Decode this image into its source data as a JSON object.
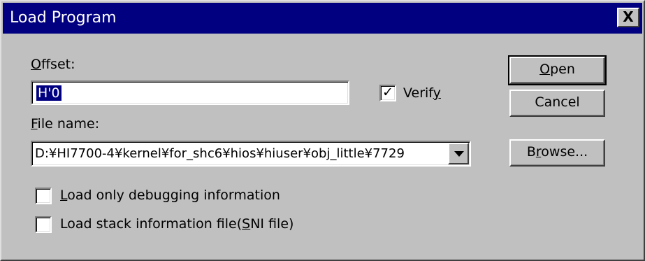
{
  "window": {
    "title": "Load Program",
    "close_label": "X"
  },
  "offset": {
    "label_hotkey": "O",
    "label_rest": "ffset:",
    "value": "H'0"
  },
  "verify": {
    "checked": true,
    "label_before": "Verif",
    "label_hotkey": "y"
  },
  "file_name": {
    "label_hotkey": "F",
    "label_rest": "ile name:",
    "value": "D:¥HI7700-4¥kernel¥for_shc6¥hios¥hiuser¥obj_little¥7729"
  },
  "options": {
    "debug_only": {
      "checked": false,
      "label_hotkey": "L",
      "label_rest": "oad only debugging information"
    },
    "stack_info": {
      "checked": false,
      "label_before": "Load stack information file(",
      "label_hotkey": "S",
      "label_after": "NI file)"
    }
  },
  "buttons": {
    "open": {
      "label_hotkey": "O",
      "label_rest": "pen"
    },
    "cancel": {
      "label": "Cancel"
    },
    "browse": {
      "label_before": "B",
      "label_hotkey": "r",
      "label_after": "owse..."
    }
  }
}
